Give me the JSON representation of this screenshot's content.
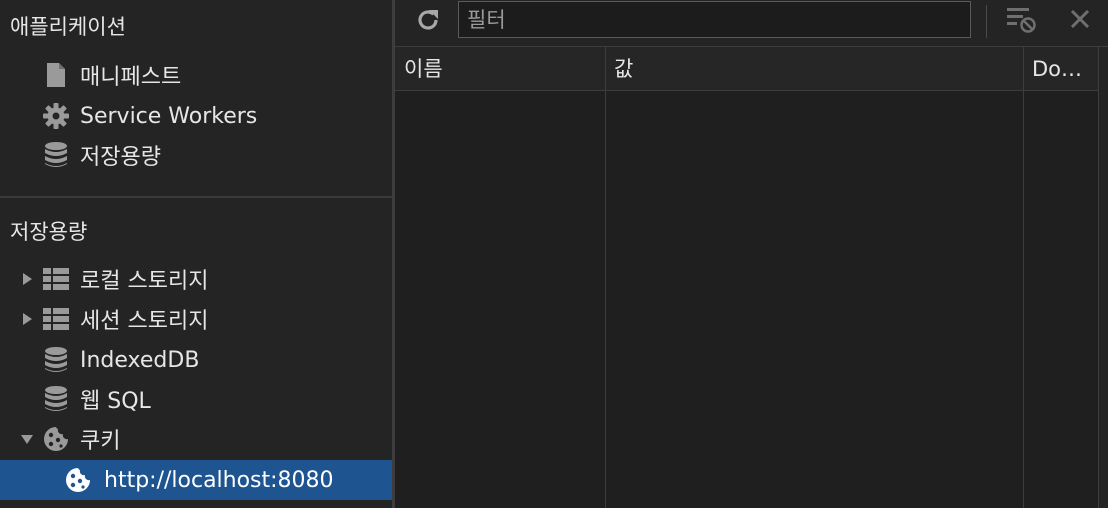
{
  "sidebar": {
    "application_title": "애플리케이션",
    "application_items": [
      {
        "label": "매니페스트",
        "icon": "document-icon"
      },
      {
        "label": "Service Workers",
        "icon": "gear-icon"
      },
      {
        "label": "저장용량",
        "icon": "database-icon"
      }
    ],
    "storage_title": "저장용량",
    "storage_items": [
      {
        "label": "로컬 스토리지",
        "icon": "table-grid-icon",
        "expand": "collapsed"
      },
      {
        "label": "세션 스토리지",
        "icon": "table-grid-icon",
        "expand": "collapsed"
      },
      {
        "label": "IndexedDB",
        "icon": "database-icon",
        "expand": "none"
      },
      {
        "label": "웹 SQL",
        "icon": "database-icon",
        "expand": "none"
      },
      {
        "label": "쿠키",
        "icon": "cookie-icon",
        "expand": "expanded"
      }
    ],
    "selected_item": {
      "label": "http://localhost:8080",
      "icon": "cookie-icon"
    }
  },
  "toolbar": {
    "refresh_icon": "refresh-icon",
    "filter_placeholder": "필터",
    "clear_filter_icon": "clear-filter-icon",
    "close_icon": "close-icon"
  },
  "table": {
    "columns": [
      "이름",
      "값",
      "Do…"
    ],
    "rows": []
  },
  "colors": {
    "selected_bg": "#1e5591",
    "panel_bg": "#242424",
    "content_bg": "#1f1f1f"
  }
}
